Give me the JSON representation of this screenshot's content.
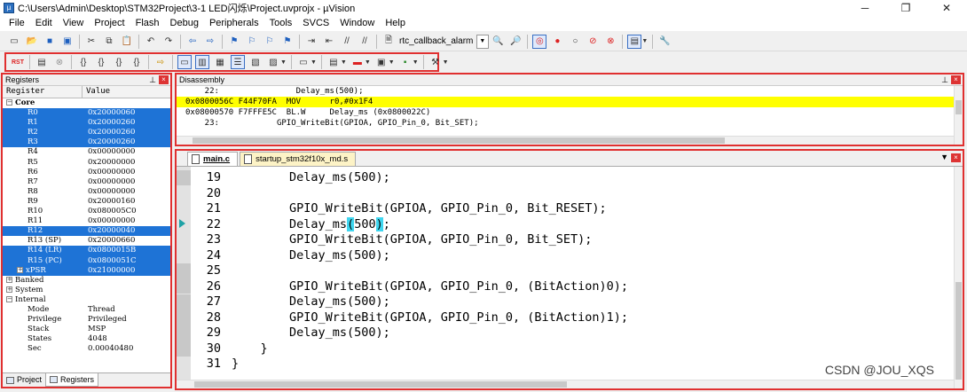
{
  "window": {
    "title": "C:\\Users\\Admin\\Desktop\\STM32Project\\3-1 LED闪烁\\Project.uvprojx - µVision",
    "controls": [
      "─",
      "❐",
      "✕"
    ]
  },
  "menu": [
    "File",
    "Edit",
    "View",
    "Project",
    "Flash",
    "Debug",
    "Peripherals",
    "Tools",
    "SVCS",
    "Window",
    "Help"
  ],
  "toolbar": {
    "target_combo": "rtc_callback_alarm"
  },
  "registers": {
    "title": "Registers",
    "col_register": "Register",
    "col_value": "Value",
    "rows": [
      {
        "name": "Core",
        "value": "",
        "level": 0,
        "exp": "−",
        "sel": false,
        "bold": true
      },
      {
        "name": "R0",
        "value": "0x20000060",
        "level": 2,
        "exp": "",
        "sel": true
      },
      {
        "name": "R1",
        "value": "0x20000260",
        "level": 2,
        "exp": "",
        "sel": true
      },
      {
        "name": "R2",
        "value": "0x20000260",
        "level": 2,
        "exp": "",
        "sel": true
      },
      {
        "name": "R3",
        "value": "0x20000260",
        "level": 2,
        "exp": "",
        "sel": true
      },
      {
        "name": "R4",
        "value": "0x00000000",
        "level": 2,
        "exp": "",
        "sel": false
      },
      {
        "name": "R5",
        "value": "0x20000000",
        "level": 2,
        "exp": "",
        "sel": false
      },
      {
        "name": "R6",
        "value": "0x00000000",
        "level": 2,
        "exp": "",
        "sel": false
      },
      {
        "name": "R7",
        "value": "0x00000000",
        "level": 2,
        "exp": "",
        "sel": false
      },
      {
        "name": "R8",
        "value": "0x00000000",
        "level": 2,
        "exp": "",
        "sel": false
      },
      {
        "name": "R9",
        "value": "0x20000160",
        "level": 2,
        "exp": "",
        "sel": false
      },
      {
        "name": "R10",
        "value": "0x080005C0",
        "level": 2,
        "exp": "",
        "sel": false
      },
      {
        "name": "R11",
        "value": "0x00000000",
        "level": 2,
        "exp": "",
        "sel": false
      },
      {
        "name": "R12",
        "value": "0x20000040",
        "level": 2,
        "exp": "",
        "sel": true
      },
      {
        "name": "R13 (SP)",
        "value": "0x20000660",
        "level": 2,
        "exp": "",
        "sel": false
      },
      {
        "name": "R14 (LR)",
        "value": "0x0800015B",
        "level": 2,
        "exp": "",
        "sel": true
      },
      {
        "name": "R15 (PC)",
        "value": "0x0800051C",
        "level": 2,
        "exp": "",
        "sel": true
      },
      {
        "name": "xPSR",
        "value": "0x21000000",
        "level": 1,
        "exp": "+",
        "sel": true
      },
      {
        "name": "Banked",
        "value": "",
        "level": 0,
        "exp": "+",
        "sel": false
      },
      {
        "name": "System",
        "value": "",
        "level": 0,
        "exp": "+",
        "sel": false
      },
      {
        "name": "Internal",
        "value": "",
        "level": 0,
        "exp": "−",
        "sel": false
      },
      {
        "name": "Mode",
        "value": "Thread",
        "level": 2,
        "exp": "",
        "sel": false
      },
      {
        "name": "Privilege",
        "value": "Privileged",
        "level": 2,
        "exp": "",
        "sel": false
      },
      {
        "name": "Stack",
        "value": "MSP",
        "level": 2,
        "exp": "",
        "sel": false
      },
      {
        "name": "States",
        "value": "4048",
        "level": 2,
        "exp": "",
        "sel": false
      },
      {
        "name": "Sec",
        "value": "0.00040480",
        "level": 2,
        "exp": "",
        "sel": false
      }
    ],
    "tabs": [
      {
        "label": "Project",
        "active": false
      },
      {
        "label": "Registers",
        "active": true
      }
    ]
  },
  "disassembly": {
    "title": "Disassembly",
    "lines": [
      {
        "text": "    22:                Delay_ms(500);",
        "hl": false
      },
      {
        "text": "0x0800056C F44F70FA  MOV      r0,#0x1F4",
        "hl": true
      },
      {
        "text": "0x08000570 F7FFFE5C  BL.W     Delay_ms (0x0800022C)",
        "hl": false
      },
      {
        "text": "    23:            GPIO_WriteBit(GPIOA, GPIO_Pin_0, Bit_SET);",
        "hl": false
      }
    ]
  },
  "editor": {
    "tabs": [
      {
        "label": "main.c",
        "active": true
      },
      {
        "label": "startup_stm32f10x_md.s",
        "active": false
      }
    ],
    "lines": [
      {
        "num": "19",
        "text": "        Delay_ms(500);"
      },
      {
        "num": "20",
        "text": ""
      },
      {
        "num": "21",
        "text": "        GPIO_WriteBit(GPIOA, GPIO_Pin_0, Bit_RESET);"
      },
      {
        "num": "22",
        "text": "        Delay_ms(500);"
      },
      {
        "num": "23",
        "text": "        GPIO_WriteBit(GPIOA, GPIO_Pin_0, Bit_SET);"
      },
      {
        "num": "24",
        "text": "        Delay_ms(500);"
      },
      {
        "num": "25",
        "text": ""
      },
      {
        "num": "26",
        "text": "        GPIO_WriteBit(GPIOA, GPIO_Pin_0, (BitAction)0);"
      },
      {
        "num": "27",
        "text": "        Delay_ms(500);"
      },
      {
        "num": "28",
        "text": "        GPIO_WriteBit(GPIOA, GPIO_Pin_0, (BitAction)1);"
      },
      {
        "num": "29",
        "text": "        Delay_ms(500);"
      },
      {
        "num": "30",
        "text": "    }"
      },
      {
        "num": "31",
        "text": "}"
      }
    ],
    "current_line": "22"
  },
  "watermark": "CSDN @JOU_XQS",
  "colors": {
    "selection": "#1e73d6",
    "current_instruction": "#ffff00",
    "bracket_match": "#3fd6ef",
    "annotation_border": "#e03030"
  }
}
